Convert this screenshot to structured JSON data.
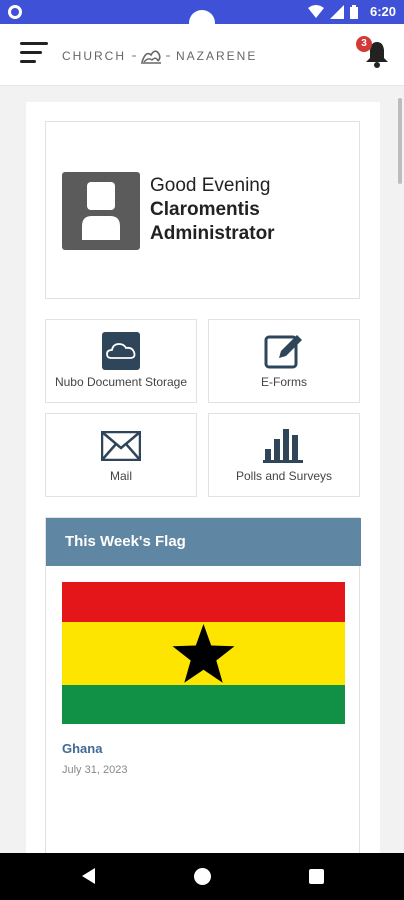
{
  "status_bar": {
    "time": "6:20"
  },
  "header": {
    "logo_left": "CHURCH",
    "logo_right": "NAZARENE",
    "notification_count": "3"
  },
  "greeting": {
    "salutation": "Good Evening",
    "name_line1": "Claromentis",
    "name_line2": "Administrator"
  },
  "tiles": [
    {
      "label": "Nubo Document Storage",
      "icon": "cloud-icon"
    },
    {
      "label": "E-Forms",
      "icon": "edit-icon"
    },
    {
      "label": "Mail",
      "icon": "mail-icon"
    },
    {
      "label": "Polls and Surveys",
      "icon": "bar-chart-icon"
    }
  ],
  "flag_panel": {
    "title": "This Week's Flag",
    "country": "Ghana",
    "date": "July 31, 2023"
  },
  "colors": {
    "status_bar": "#3f51d6",
    "panel_header": "#5f86a2",
    "link": "#3e6a93",
    "badge": "#d23a3a",
    "tile_icon": "#2f4559"
  }
}
